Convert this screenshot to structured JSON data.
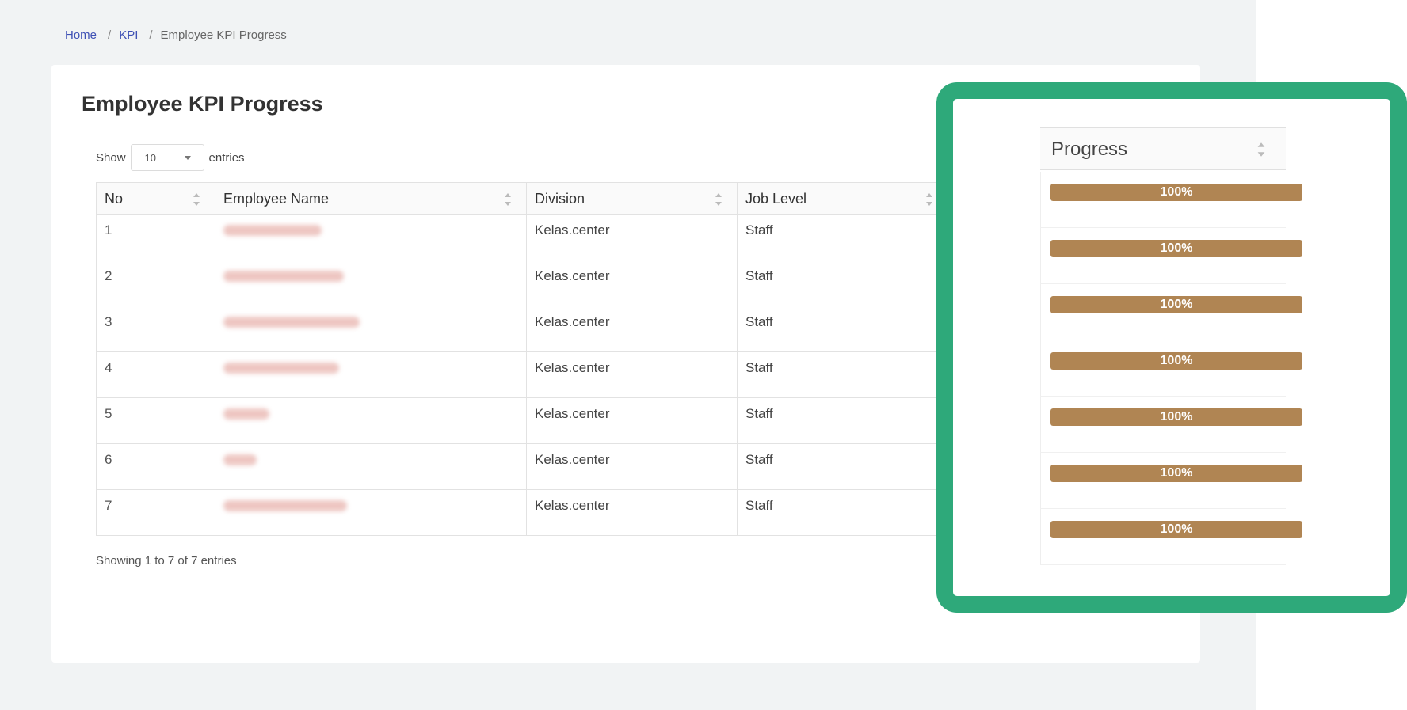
{
  "breadcrumb": {
    "home": "Home",
    "kpi": "KPI",
    "current": "Employee KPI Progress"
  },
  "page": {
    "title": "Employee KPI Progress"
  },
  "length": {
    "show_label": "Show",
    "value": "10",
    "entries_label": "entries"
  },
  "table": {
    "columns": [
      "No",
      "Employee Name",
      "Division",
      "Job Level"
    ],
    "rows": [
      {
        "no": "1",
        "division": "Kelas.center",
        "job_level": "Staff"
      },
      {
        "no": "2",
        "division": "Kelas.center",
        "job_level": "Staff"
      },
      {
        "no": "3",
        "division": "Kelas.center",
        "job_level": "Staff"
      },
      {
        "no": "4",
        "division": "Kelas.center",
        "job_level": "Staff"
      },
      {
        "no": "5",
        "division": "Kelas.center",
        "job_level": "Staff"
      },
      {
        "no": "6",
        "division": "Kelas.center",
        "job_level": "Staff"
      },
      {
        "no": "7",
        "division": "Kelas.center",
        "job_level": "Staff"
      }
    ],
    "info": "Showing 1 to 7 of 7 entries"
  },
  "progress": {
    "header": "Progress",
    "bar_color": "#b08553",
    "highlight_color": "#2ea97a",
    "values": [
      {
        "label": "100%",
        "fraction": 1.0
      },
      {
        "label": "100%",
        "fraction": 1.0
      },
      {
        "label": "100%",
        "fraction": 1.0
      },
      {
        "label": "100%",
        "fraction": 1.0
      },
      {
        "label": "100%",
        "fraction": 1.0
      },
      {
        "label": "100%",
        "fraction": 1.0
      },
      {
        "label": "100%",
        "fraction": 1.0
      }
    ]
  },
  "icons": {
    "sort": "sort-icon",
    "dropdown": "caret-down-icon"
  }
}
